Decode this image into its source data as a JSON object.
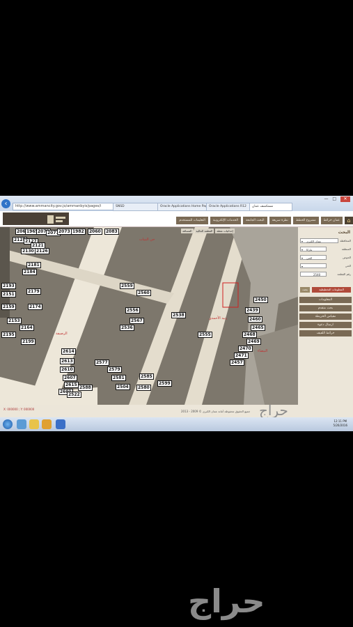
{
  "browser": {
    "address": "http://www.ammancity.gov.jo/ammanbyis/pages/i",
    "tabs": [
      "SNSD",
      "Oracle Applications Home Page",
      "Oracle Applications R12",
      "مستكشف عمان"
    ],
    "window_controls": [
      "—",
      "□",
      "✕"
    ]
  },
  "app_nav": [
    "عمان خرائط",
    "مشروع الخطط",
    "نظرة سريعة",
    "البحث الجامعة",
    "الخدمات الإلكترونية",
    "التعليمات للمستخدم"
  ],
  "map_tabs": [
    "المسافة",
    "القطعة الحالية",
    "إحداثيات نقطة"
  ],
  "parcels": [
    "2064",
    "1965",
    "2070",
    "2071",
    "2073",
    "1982",
    "2060",
    "2083",
    "2125",
    "2127",
    "2121",
    "2126",
    "2130",
    "2181",
    "2184",
    "2193",
    "2151",
    "2179",
    "2174",
    "2159",
    "2153",
    "2164",
    "2195",
    "2199",
    "2559",
    "2560",
    "2556",
    "2567",
    "2536",
    "2555",
    "2577",
    "2579",
    "2581",
    "2504",
    "2585",
    "2450",
    "2439",
    "2460",
    "2465",
    "2468",
    "2469",
    "2470",
    "2471",
    "2457",
    "2614",
    "2613",
    "2610",
    "2607",
    "2615",
    "2601",
    "2538",
    "2522",
    "2588",
    "2580",
    "2599"
  ],
  "place_labels": [
    "حي البنيات",
    "زنيد الأحمدي",
    "الرصيفة",
    "البيضاء"
  ],
  "panel": {
    "title": "البحث",
    "fields": [
      {
        "label": "المحافظة",
        "value": "عمان الكبرى"
      },
      {
        "label": "المنطقة",
        "value": "ماركا"
      },
      {
        "label": "الحوض",
        "value": "الحي"
      },
      {
        "label": "الحي",
        "value": ""
      },
      {
        "label": "رقم القطعة",
        "value": "2540"
      }
    ],
    "search_button": "بحث",
    "clear_button": "المعلومات التخطيطية",
    "menu": [
      "المعلومات",
      "بحث متقدم",
      "مقياس الخريطة",
      "ارسال دعوة",
      "خرائط اللفيف"
    ]
  },
  "footer": {
    "coords": "X: 000000 ; Y: 000000",
    "copyright": "جميع الحقوق محفوظة أمانة عمان الكبرى © 2009 - 2013",
    "watermark": "حراج"
  },
  "taskbar": {
    "time": "12:11 PM",
    "date": "5/26/2016"
  },
  "watermark_large": "حراج"
}
